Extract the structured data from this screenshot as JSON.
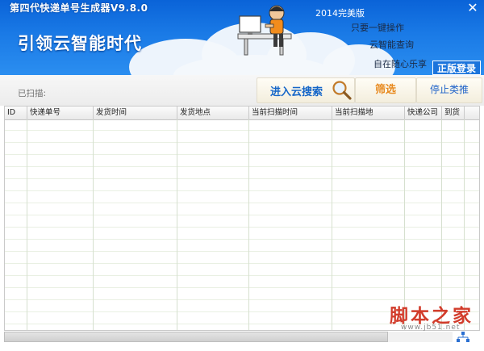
{
  "window": {
    "title": "第四代快递单号生成器V9.8.0",
    "close_glyph": "✕"
  },
  "banner": {
    "slogan": "引领云智能时代",
    "edition": "2014完美版",
    "features": [
      "只要一键操作",
      "云智能查询",
      "自在随心乐享"
    ],
    "login_label": "正版登录"
  },
  "toolbar": {
    "scanned_label": "已扫描:",
    "cloud_search_label": "进入云搜索",
    "filter_label": "筛选",
    "stop_label": "停止类推"
  },
  "table": {
    "columns": [
      "ID",
      "快递单号",
      "发货时间",
      "发货地点",
      "当前扫描时间",
      "当前扫描地",
      "快递公司",
      "到货"
    ],
    "rows": []
  },
  "watermark": {
    "logo": "脚本之家",
    "url": "www.jb51.net"
  },
  "icons": {
    "close": "close-icon",
    "search": "magnifier-icon",
    "status": "network-icon",
    "mascot": "mascot-illustration"
  },
  "colors": {
    "banner_blue": "#1a7ae6",
    "cloud_search_text": "#1566c8",
    "filter_text": "#e88b21",
    "grid_line": "#e9f0e3"
  }
}
